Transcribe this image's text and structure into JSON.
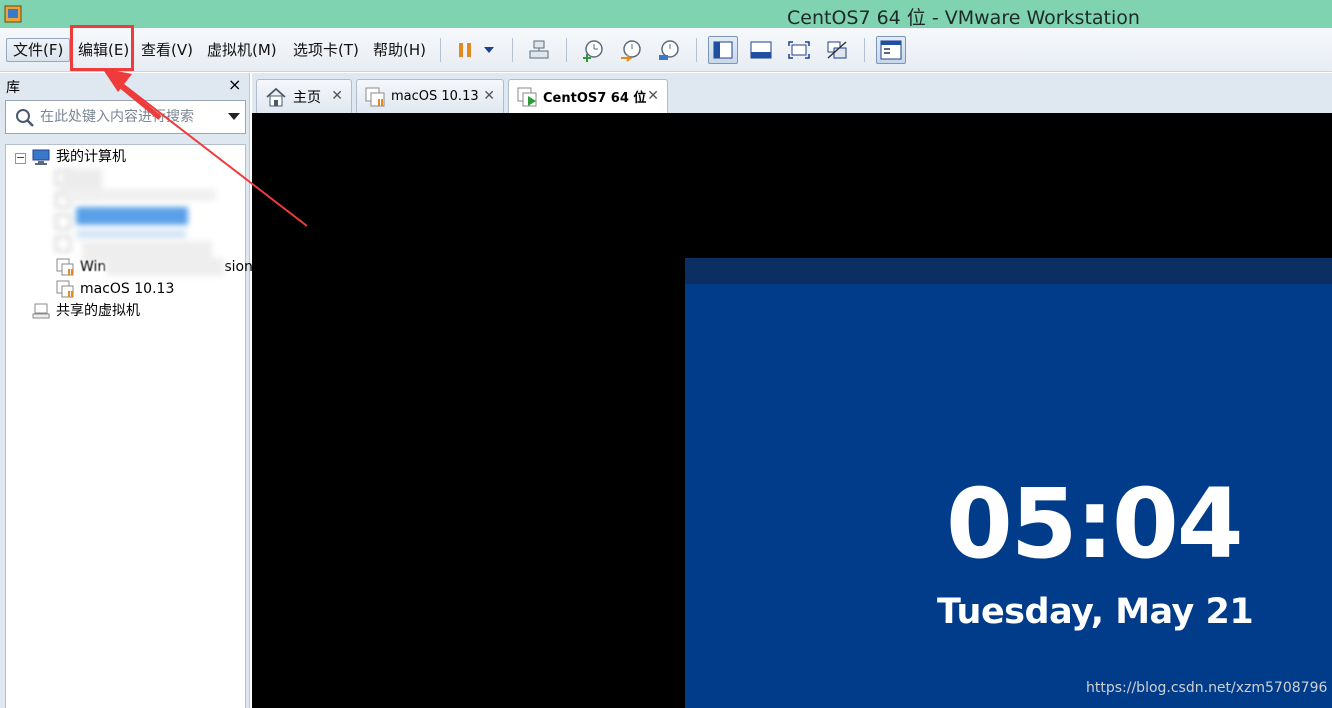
{
  "window": {
    "title": "CentOS7 64 位 - VMware Workstation"
  },
  "menu": {
    "items": [
      {
        "label": "文件(F)"
      },
      {
        "label": "编辑(E)"
      },
      {
        "label": "查看(V)"
      },
      {
        "label": "虚拟机(M)"
      },
      {
        "label": "选项卡(T)"
      },
      {
        "label": "帮助(H)"
      }
    ],
    "highlighted_item": "编辑(E)"
  },
  "toolbar": {
    "buttons": [
      "pause-icon",
      "dropdown-arrow-icon",
      "send-ctrl-alt-del-icon",
      "snapshot-take-icon",
      "snapshot-revert-icon",
      "snapshot-manager-icon",
      "show-library-icon",
      "thumbnail-bar-icon",
      "full-screen-icon",
      "unity-icon",
      "console-view-icon"
    ]
  },
  "library": {
    "title": "库",
    "close": "×",
    "search_placeholder": "在此处键入内容进行搜索",
    "tree": {
      "root": "我的计算机",
      "visible_items": [
        {
          "label": "macOS 10.13"
        }
      ],
      "partial_item_fragment": "Win",
      "partial_item_tail": "sion",
      "shared": "共享的虚拟机"
    }
  },
  "tabs": [
    {
      "label": "主页",
      "icon": "home-icon"
    },
    {
      "label": "macOS 10.13",
      "icon": "vm-icon"
    },
    {
      "label": "CentOS7 64 位",
      "icon": "vm-running-icon",
      "active": true
    }
  ],
  "guest_screen": {
    "time": "05:04",
    "date": "Tuesday, May 21"
  },
  "watermark": "https://blog.csdn.net/xzm5708796",
  "colors": {
    "titlebar": "#7fd3b0",
    "lockscreen": "#013c8b",
    "annotation": "#ee3b3b"
  }
}
